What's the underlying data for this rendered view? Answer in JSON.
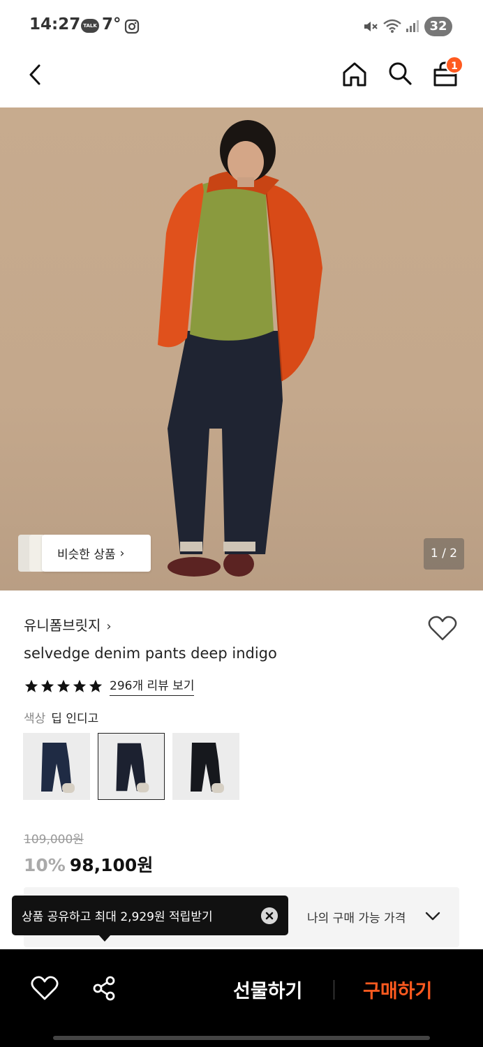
{
  "status_bar": {
    "time": "14:27",
    "talk_badge": "TALK",
    "temperature": "7°",
    "battery": "32"
  },
  "top_nav": {
    "cart_count": "1"
  },
  "hero": {
    "similar_button_label": "비슷한 상품",
    "similar_button_chevron": "›",
    "page_indicator": "1 / 2"
  },
  "product": {
    "brand": "유니폼브릿지",
    "brand_chevron": "›",
    "name": "selvedge denim pants deep indigo",
    "rating_stars": 5,
    "review_link": "296개 리뷰 보기",
    "color_label": "색상",
    "color_value": "딥 인디고",
    "original_price": "109,000원",
    "discount": "10%",
    "final_price": "98,100원",
    "my_price_label": "나의 구매 가능 가격"
  },
  "tooltip": {
    "text": "상품 공유하고 최대 2,929원 적립받기"
  },
  "bottom_bar": {
    "gift_label": "선물하기",
    "buy_label": "구매하기"
  },
  "colors": {
    "accent": "#ff5a1f",
    "bottom_bar_bg": "#000000",
    "hero_bg": "#c7ab8e"
  },
  "icons": [
    "back-arrow-icon",
    "home-icon",
    "search-icon",
    "shopping-bag-icon",
    "heart-icon",
    "star-icon",
    "share-icon",
    "close-icon",
    "chevron-down-icon"
  ]
}
